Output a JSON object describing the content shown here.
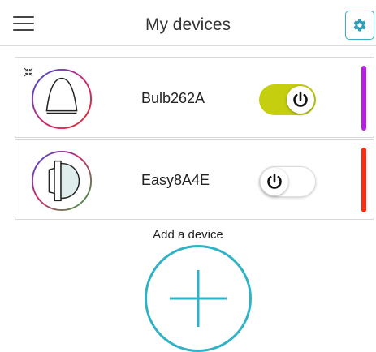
{
  "header": {
    "title": "My devices",
    "menu_icon": "hamburger-menu-icon",
    "settings_icon": "gear-icon"
  },
  "devices": [
    {
      "name": "Bulb262A",
      "icon": "bulb-dome-icon",
      "power": "on",
      "accent_color": "#b81ee6",
      "toggle_color": "#c5cf10"
    },
    {
      "name": "Easy8A4E",
      "icon": "bulb-side-icon",
      "power": "off",
      "accent_color": "#ff2a12"
    }
  ],
  "add_device": {
    "label": "Add a device",
    "icon": "plus-icon",
    "color": "#2fb2c6"
  }
}
